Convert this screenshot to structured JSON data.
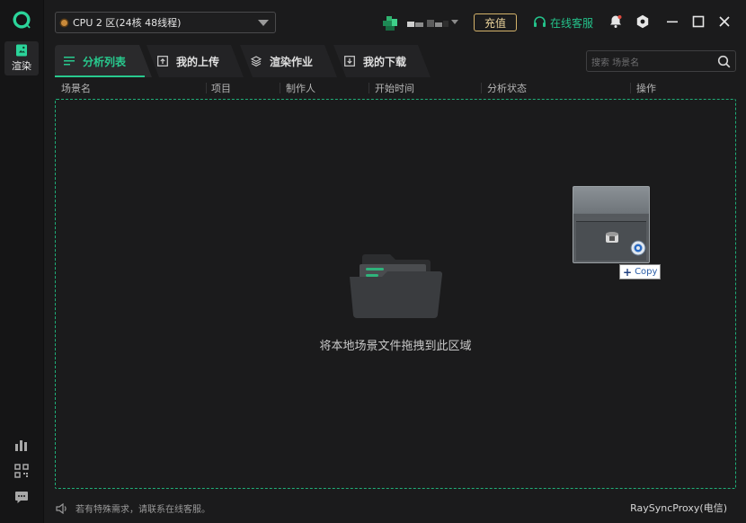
{
  "sidebar": {
    "logo_icon": "app-logo-icon",
    "render_label": "渲染",
    "bottom_icons": [
      "stats-icon",
      "qr-code-icon",
      "message-icon"
    ]
  },
  "header": {
    "cpu_selector": "CPU 2 区(24核 48线程)",
    "recharge_label": "充值",
    "support_label": "在线客服",
    "icons": [
      "bell-icon",
      "gear-icon",
      "minimize-icon",
      "maximize-icon",
      "close-icon"
    ]
  },
  "tabs": [
    {
      "label": "分析列表",
      "icon": "list-icon",
      "active": true
    },
    {
      "label": "我的上传",
      "icon": "upload-icon",
      "active": false
    },
    {
      "label": "渲染作业",
      "icon": "layers-icon",
      "active": false
    },
    {
      "label": "我的下载",
      "icon": "download-icon",
      "active": false
    }
  ],
  "search": {
    "placeholder": "搜索 场景名"
  },
  "table": {
    "columns": [
      "场景名",
      "项目",
      "制作人",
      "开始时间",
      "分析状态",
      "操作"
    ]
  },
  "dropzone": {
    "hint": "将本地场景文件拖拽到此区域",
    "drag_badge": "Copy"
  },
  "footer": {
    "notice": "若有特殊需求，请联系在线客服。",
    "proxy": "RaySyncProxy(电信)"
  },
  "colors": {
    "accent": "#28c98e",
    "dash": "#1fae78",
    "recharge": "#d4b36a",
    "background": "#1b1b1c"
  }
}
